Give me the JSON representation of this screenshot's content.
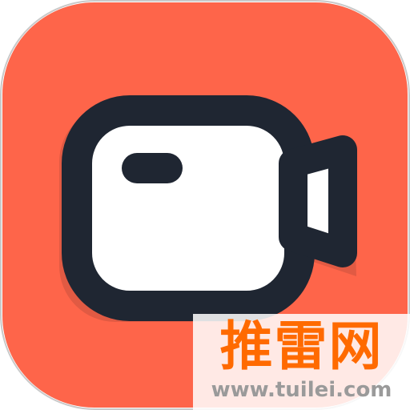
{
  "icon": {
    "name": "video-camera-icon",
    "background_color": "#fe654a",
    "shadow_color": "#e15a43",
    "stroke_color": "#1f2632",
    "fill_color": "#ffffff"
  },
  "watermark": {
    "title": "推雷网",
    "url": "www.tuilei.com",
    "title_color": "#ff6a00",
    "url_color": "#9a9a9a"
  }
}
